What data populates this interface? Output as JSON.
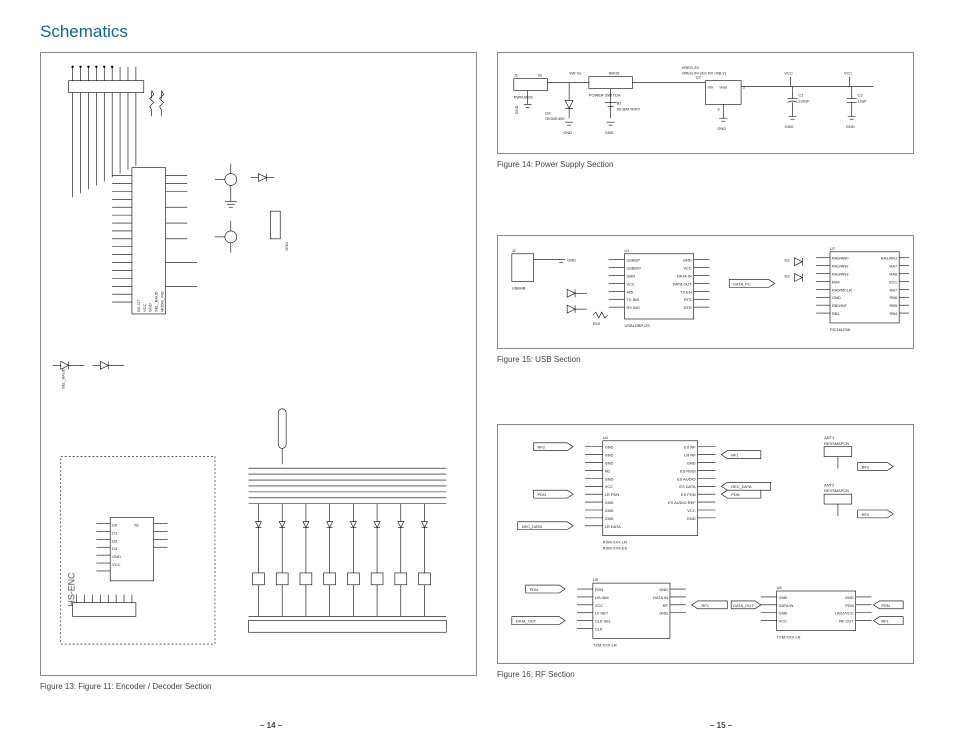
{
  "title": "Schematics",
  "left": {
    "enc_label": "HS-ENC",
    "caption": "Figure 13: Figure 11: Encoder / Decoder Section"
  },
  "fig14": {
    "caption": "Figure 14: Power Supply Section",
    "j1": "J1",
    "vs": "Vs",
    "swvs": "SW Vs",
    "sw15": "SW15",
    "pwrjack": "PWRJACK",
    "power_switch": "POWER SWITCH",
    "vreg3": "VREG-3V",
    "vreg5": "VREG-5V (ES RX ONLY)",
    "u2": "U2",
    "vin": "Vin",
    "vout": "Vout",
    "d9": "D9",
    "diode400": "DIODE400",
    "b1": "B1",
    "batt": "9V BATTERY",
    "c1": "C1",
    "c1v": "220uF",
    "c2": "C2",
    "c2v": "10uF",
    "vcc": "VCC",
    "gnd": "GND"
  },
  "fig15": {
    "caption": "Figure 15: USB Section",
    "j2": "J2",
    "usbhb": "USBHB",
    "u1": "U1",
    "usbdp": "USBDP",
    "usbdm": "USBDM",
    "gnd": "GND",
    "vcc": "VCC",
    "txind": "TX IND",
    "rxind": "RX IND",
    "datain": "DATA IN",
    "dataout": "DATA OUT",
    "rts": "RTS",
    "dtr": "DTR",
    "part": "USBI-DBP-DS",
    "d2": "D2",
    "d3": "D3",
    "data_pc": "DATA_PC",
    "u7": "U7",
    "ra0": "RA0/AN0",
    "ra1": "RA1/AN1",
    "ra2": "RA2/AN2",
    "ra3": "RA3/AN3",
    "mclr": "RA5/MCLR",
    "rb0": "RB0/INT",
    "rb4": "RB4",
    "rb5": "RB5",
    "pic": "PIC16LF88"
  },
  "fig16": {
    "caption": "Figure 16: RF Section",
    "u4": "U4",
    "u5": "U5",
    "u6": "U6",
    "gnd": "GND",
    "vcc": "VCC",
    "nc": "NC",
    "es_rf": "ES RF",
    "lr_rf": "LR RF",
    "es_rssi": "ES RSSI",
    "es_audio": "ES AUDIO",
    "es_data": "ES DATA",
    "es_pdn": "ES PDN",
    "lr_pdn": "LR PDN",
    "lr_data": "LR DATA",
    "rf1": "RF1",
    "rf2": "RF2",
    "rf3": "RF3",
    "pdn": "PDN",
    "data_out": "DATA_OUT",
    "data_in": "DATA IN",
    "dec_data": "DEC_DATA",
    "rxm": "RXM-XXX-LR",
    "txm": "TXM-XXX-LR",
    "rxes": "RXM-XXX-ES",
    "ant1": "ANT1",
    "ant2": "ANT2",
    "revsma": "REVSMAPCB",
    "lvl": "LVL/AM",
    "lvldet": "LV DET",
    "clksel": "CLK SEL",
    "clk": "CLK",
    "ladj": "LADJ/VCC",
    "rfout": "RF OUT"
  },
  "pages": {
    "left": "– 14 –",
    "right": "– 15 –"
  }
}
